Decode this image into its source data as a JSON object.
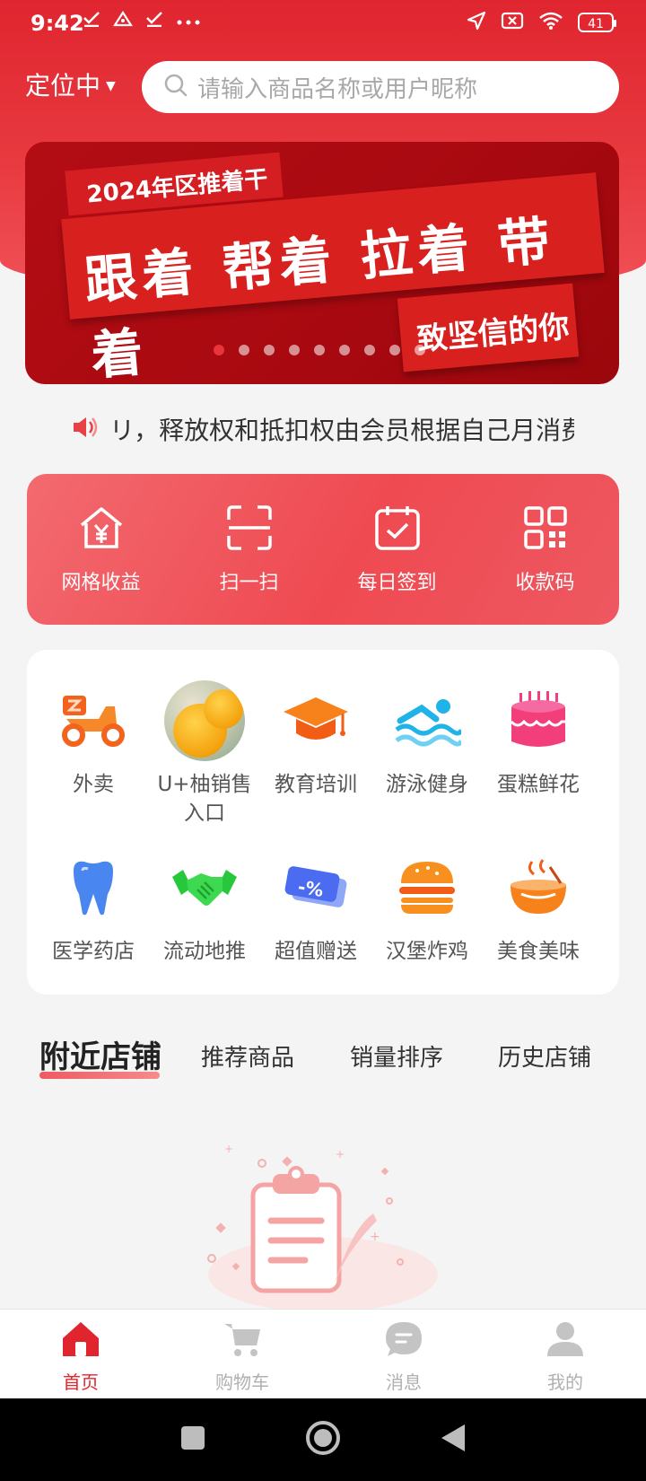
{
  "status_bar": {
    "time": "9:42",
    "battery": "41"
  },
  "header": {
    "location_label": "定位中",
    "search_placeholder": "请输入商品名称或用户昵称"
  },
  "banner": {
    "tagline": "2024年区推着干",
    "headline": "跟着 帮着 拉着 带着",
    "sub": "致坚信的你",
    "slide_count": 9,
    "active_slide": 0
  },
  "notice": {
    "text": "リ，释放权和抵扣权由会员根据自己月消费"
  },
  "quick_actions": [
    {
      "label": "网格收益",
      "icon": "yen-house-icon"
    },
    {
      "label": "扫一扫",
      "icon": "scan-icon"
    },
    {
      "label": "每日签到",
      "icon": "calendar-check-icon"
    },
    {
      "label": "收款码",
      "icon": "qr-code-icon"
    }
  ],
  "categories": [
    {
      "label": "外卖",
      "icon": "scooter-icon"
    },
    {
      "label": "U+柚销售入口",
      "icon": "orange-photo"
    },
    {
      "label": "教育培训",
      "icon": "graduation-cap-icon"
    },
    {
      "label": "游泳健身",
      "icon": "swimming-icon"
    },
    {
      "label": "蛋糕鲜花",
      "icon": "cake-icon"
    },
    {
      "label": "医学药店",
      "icon": "tooth-icon"
    },
    {
      "label": "流动地推",
      "icon": "handshake-icon"
    },
    {
      "label": "超值赠送",
      "icon": "coupon-icon"
    },
    {
      "label": "汉堡炸鸡",
      "icon": "burger-icon"
    },
    {
      "label": "美食美味",
      "icon": "bowl-icon"
    }
  ],
  "tabs": [
    {
      "label": "附近店铺",
      "active": true
    },
    {
      "label": "推荐商品",
      "active": false
    },
    {
      "label": "销量排序",
      "active": false
    },
    {
      "label": "历史店铺",
      "active": false
    }
  ],
  "bottom_nav": [
    {
      "label": "首页",
      "icon": "home-icon",
      "active": true
    },
    {
      "label": "购物车",
      "icon": "cart-icon",
      "active": false
    },
    {
      "label": "消息",
      "icon": "message-icon",
      "active": false
    },
    {
      "label": "我的",
      "icon": "profile-icon",
      "active": false
    }
  ],
  "colors": {
    "primary": "#e0252f",
    "accent_light": "#f05a5f",
    "muted": "#b0b0b0"
  }
}
